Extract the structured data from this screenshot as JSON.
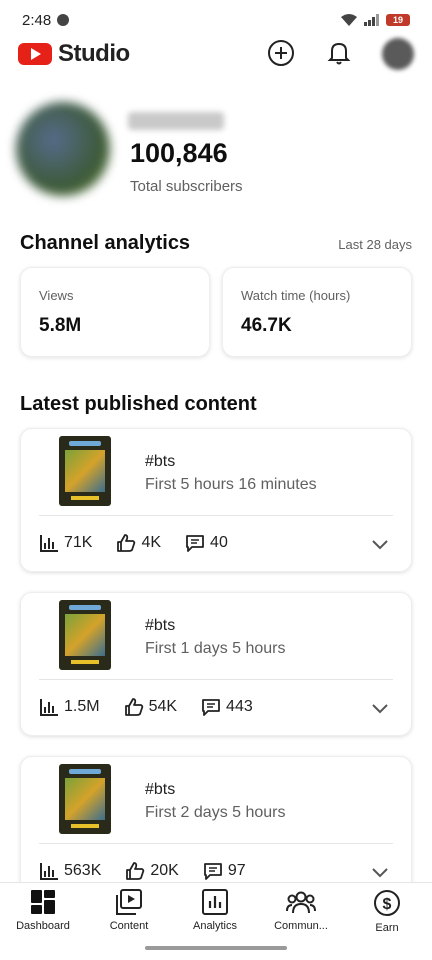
{
  "status_bar": {
    "time": "2:48",
    "battery": "19"
  },
  "header": {
    "logo_text": "Studio"
  },
  "channel": {
    "subscribers": "100,846",
    "subscribers_label": "Total subscribers"
  },
  "analytics": {
    "title": "Channel analytics",
    "range": "Last 28 days",
    "stats": [
      {
        "label": "Views",
        "value": "5.8M"
      },
      {
        "label": "Watch time (hours)",
        "value": "46.7K"
      }
    ]
  },
  "latest": {
    "title": "Latest published content",
    "videos": [
      {
        "title": "#bts",
        "subtitle": "First 5 hours 16 minutes",
        "views": "71K",
        "likes": "4K",
        "comments": "40"
      },
      {
        "title": "#bts",
        "subtitle": "First 1 days 5 hours",
        "views": "1.5M",
        "likes": "54K",
        "comments": "443"
      },
      {
        "title": "#bts",
        "subtitle": "First 2 days 5 hours",
        "views": "563K",
        "likes": "20K",
        "comments": "97"
      }
    ]
  },
  "bottom_nav": [
    {
      "label": "Dashboard",
      "icon": "dashboard-icon"
    },
    {
      "label": "Content",
      "icon": "content-icon"
    },
    {
      "label": "Analytics",
      "icon": "analytics-icon"
    },
    {
      "label": "Commun...",
      "icon": "community-icon"
    },
    {
      "label": "Earn",
      "icon": "earn-icon"
    }
  ]
}
